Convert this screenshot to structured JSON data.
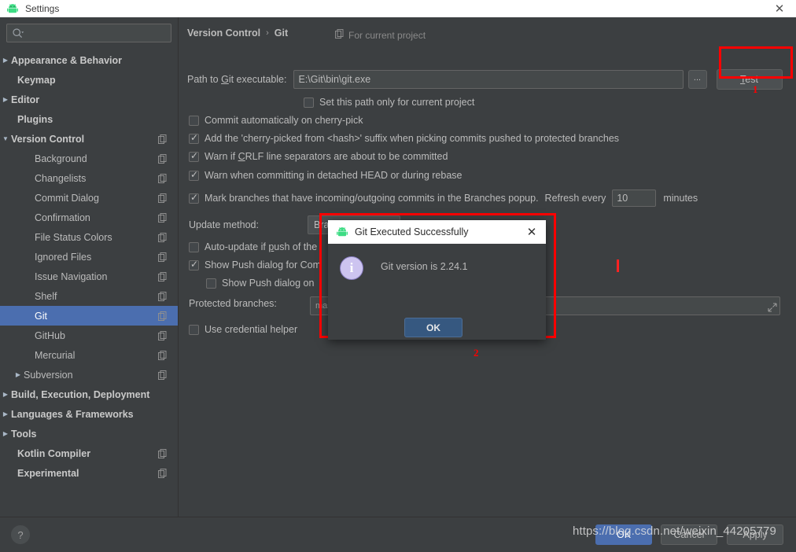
{
  "window": {
    "title": "Settings",
    "icon": "android-icon",
    "close_label": "✕"
  },
  "sidebar": {
    "search": {
      "placeholder": "",
      "value": "",
      "icon": "search-icon"
    },
    "items": [
      {
        "label": "Appearance & Behavior",
        "arrow": "▶",
        "bold": true,
        "indent": 8,
        "copy": false,
        "selected": false
      },
      {
        "label": "Keymap",
        "arrow": "",
        "bold": true,
        "indent": 22,
        "copy": false,
        "selected": false
      },
      {
        "label": "Editor",
        "arrow": "▶",
        "bold": true,
        "indent": 8,
        "copy": false,
        "selected": false
      },
      {
        "label": "Plugins",
        "arrow": "",
        "bold": true,
        "indent": 22,
        "copy": false,
        "selected": false
      },
      {
        "label": "Version Control",
        "arrow": "▼",
        "bold": true,
        "indent": 8,
        "copy": true,
        "selected": false
      },
      {
        "label": "Background",
        "arrow": "",
        "bold": false,
        "indent": 44,
        "copy": true,
        "selected": false
      },
      {
        "label": "Changelists",
        "arrow": "",
        "bold": false,
        "indent": 44,
        "copy": true,
        "selected": false
      },
      {
        "label": "Commit Dialog",
        "arrow": "",
        "bold": false,
        "indent": 44,
        "copy": true,
        "selected": false
      },
      {
        "label": "Confirmation",
        "arrow": "",
        "bold": false,
        "indent": 44,
        "copy": true,
        "selected": false
      },
      {
        "label": "File Status Colors",
        "arrow": "",
        "bold": false,
        "indent": 44,
        "copy": true,
        "selected": false
      },
      {
        "label": "Ignored Files",
        "arrow": "",
        "bold": false,
        "indent": 44,
        "copy": true,
        "selected": false
      },
      {
        "label": "Issue Navigation",
        "arrow": "",
        "bold": false,
        "indent": 44,
        "copy": true,
        "selected": false
      },
      {
        "label": "Shelf",
        "arrow": "",
        "bold": false,
        "indent": 44,
        "copy": true,
        "selected": false
      },
      {
        "label": "Git",
        "arrow": "",
        "bold": false,
        "indent": 44,
        "copy": true,
        "selected": true
      },
      {
        "label": "GitHub",
        "arrow": "",
        "bold": false,
        "indent": 44,
        "copy": true,
        "selected": false
      },
      {
        "label": "Mercurial",
        "arrow": "",
        "bold": false,
        "indent": 44,
        "copy": true,
        "selected": false
      },
      {
        "label": "Subversion",
        "arrow": "▶",
        "bold": false,
        "indent": 30,
        "copy": true,
        "selected": false
      },
      {
        "label": "Build, Execution, Deployment",
        "arrow": "▶",
        "bold": true,
        "indent": 8,
        "copy": false,
        "selected": false
      },
      {
        "label": "Languages & Frameworks",
        "arrow": "▶",
        "bold": true,
        "indent": 8,
        "copy": false,
        "selected": false
      },
      {
        "label": "Tools",
        "arrow": "▶",
        "bold": true,
        "indent": 8,
        "copy": false,
        "selected": false
      },
      {
        "label": "Kotlin Compiler",
        "arrow": "",
        "bold": true,
        "indent": 22,
        "copy": true,
        "selected": false
      },
      {
        "label": "Experimental",
        "arrow": "",
        "bold": true,
        "indent": 22,
        "copy": true,
        "selected": false
      }
    ]
  },
  "main": {
    "breadcrumb_root": "Version Control",
    "breadcrumb_sep": "›",
    "breadcrumb_leaf": "Git",
    "for_current_project": "For current project",
    "path_label_pre": "Path to ",
    "path_label_accel": "G",
    "path_label_post": "it executable:",
    "path_value": "E:\\Git\\bin\\git.exe",
    "browse_label": "...",
    "test_label_pre": "",
    "test_label_accel": "T",
    "test_label_post": "est",
    "checkboxes": [
      {
        "label": "Set this path only for current project",
        "checked": false
      },
      {
        "label": "Commit automatically on cherry-pick",
        "checked": false
      },
      {
        "label": "Add the 'cherry-picked from <hash>' suffix when picking commits pushed to protected branches",
        "checked": true
      },
      {
        "label": "Warn if CRLF line separators are about to be committed",
        "checked": true
      },
      {
        "label": "Warn when committing in detached HEAD or during rebase",
        "checked": true
      }
    ],
    "mark_branches_label": "Mark branches that have incoming/outgoing commits in the Branches popup.",
    "refresh_every_label": "Refresh every",
    "refresh_minutes_value": "10",
    "minutes_label": "minutes",
    "update_method_label": "Update method:",
    "update_method_value": "Branch default",
    "auto_update_label": "Auto-update if push of the",
    "show_push_commit_label": "Show Push dialog for Com",
    "show_push_only_label": "Show Push dialog on",
    "protected_branches_label": "Protected branches:",
    "protected_branches_value": "mas",
    "use_credential_label": "Use credential helper"
  },
  "dialog": {
    "title": "Git Executed Successfully",
    "icon": "android-icon",
    "close_label": "✕",
    "info_icon": "info-icon",
    "message": "Git version is 2.24.1",
    "ok_label": "OK"
  },
  "bottom": {
    "help_label": "?",
    "ok_label": "OK",
    "cancel_label": "Cancel",
    "apply_label": "Apply"
  },
  "annotations": {
    "marker_1": "1",
    "marker_2": "2",
    "accent_color": "#ff0000"
  },
  "watermark": {
    "text": "https://blog.csdn.net/weixin_44205779"
  }
}
